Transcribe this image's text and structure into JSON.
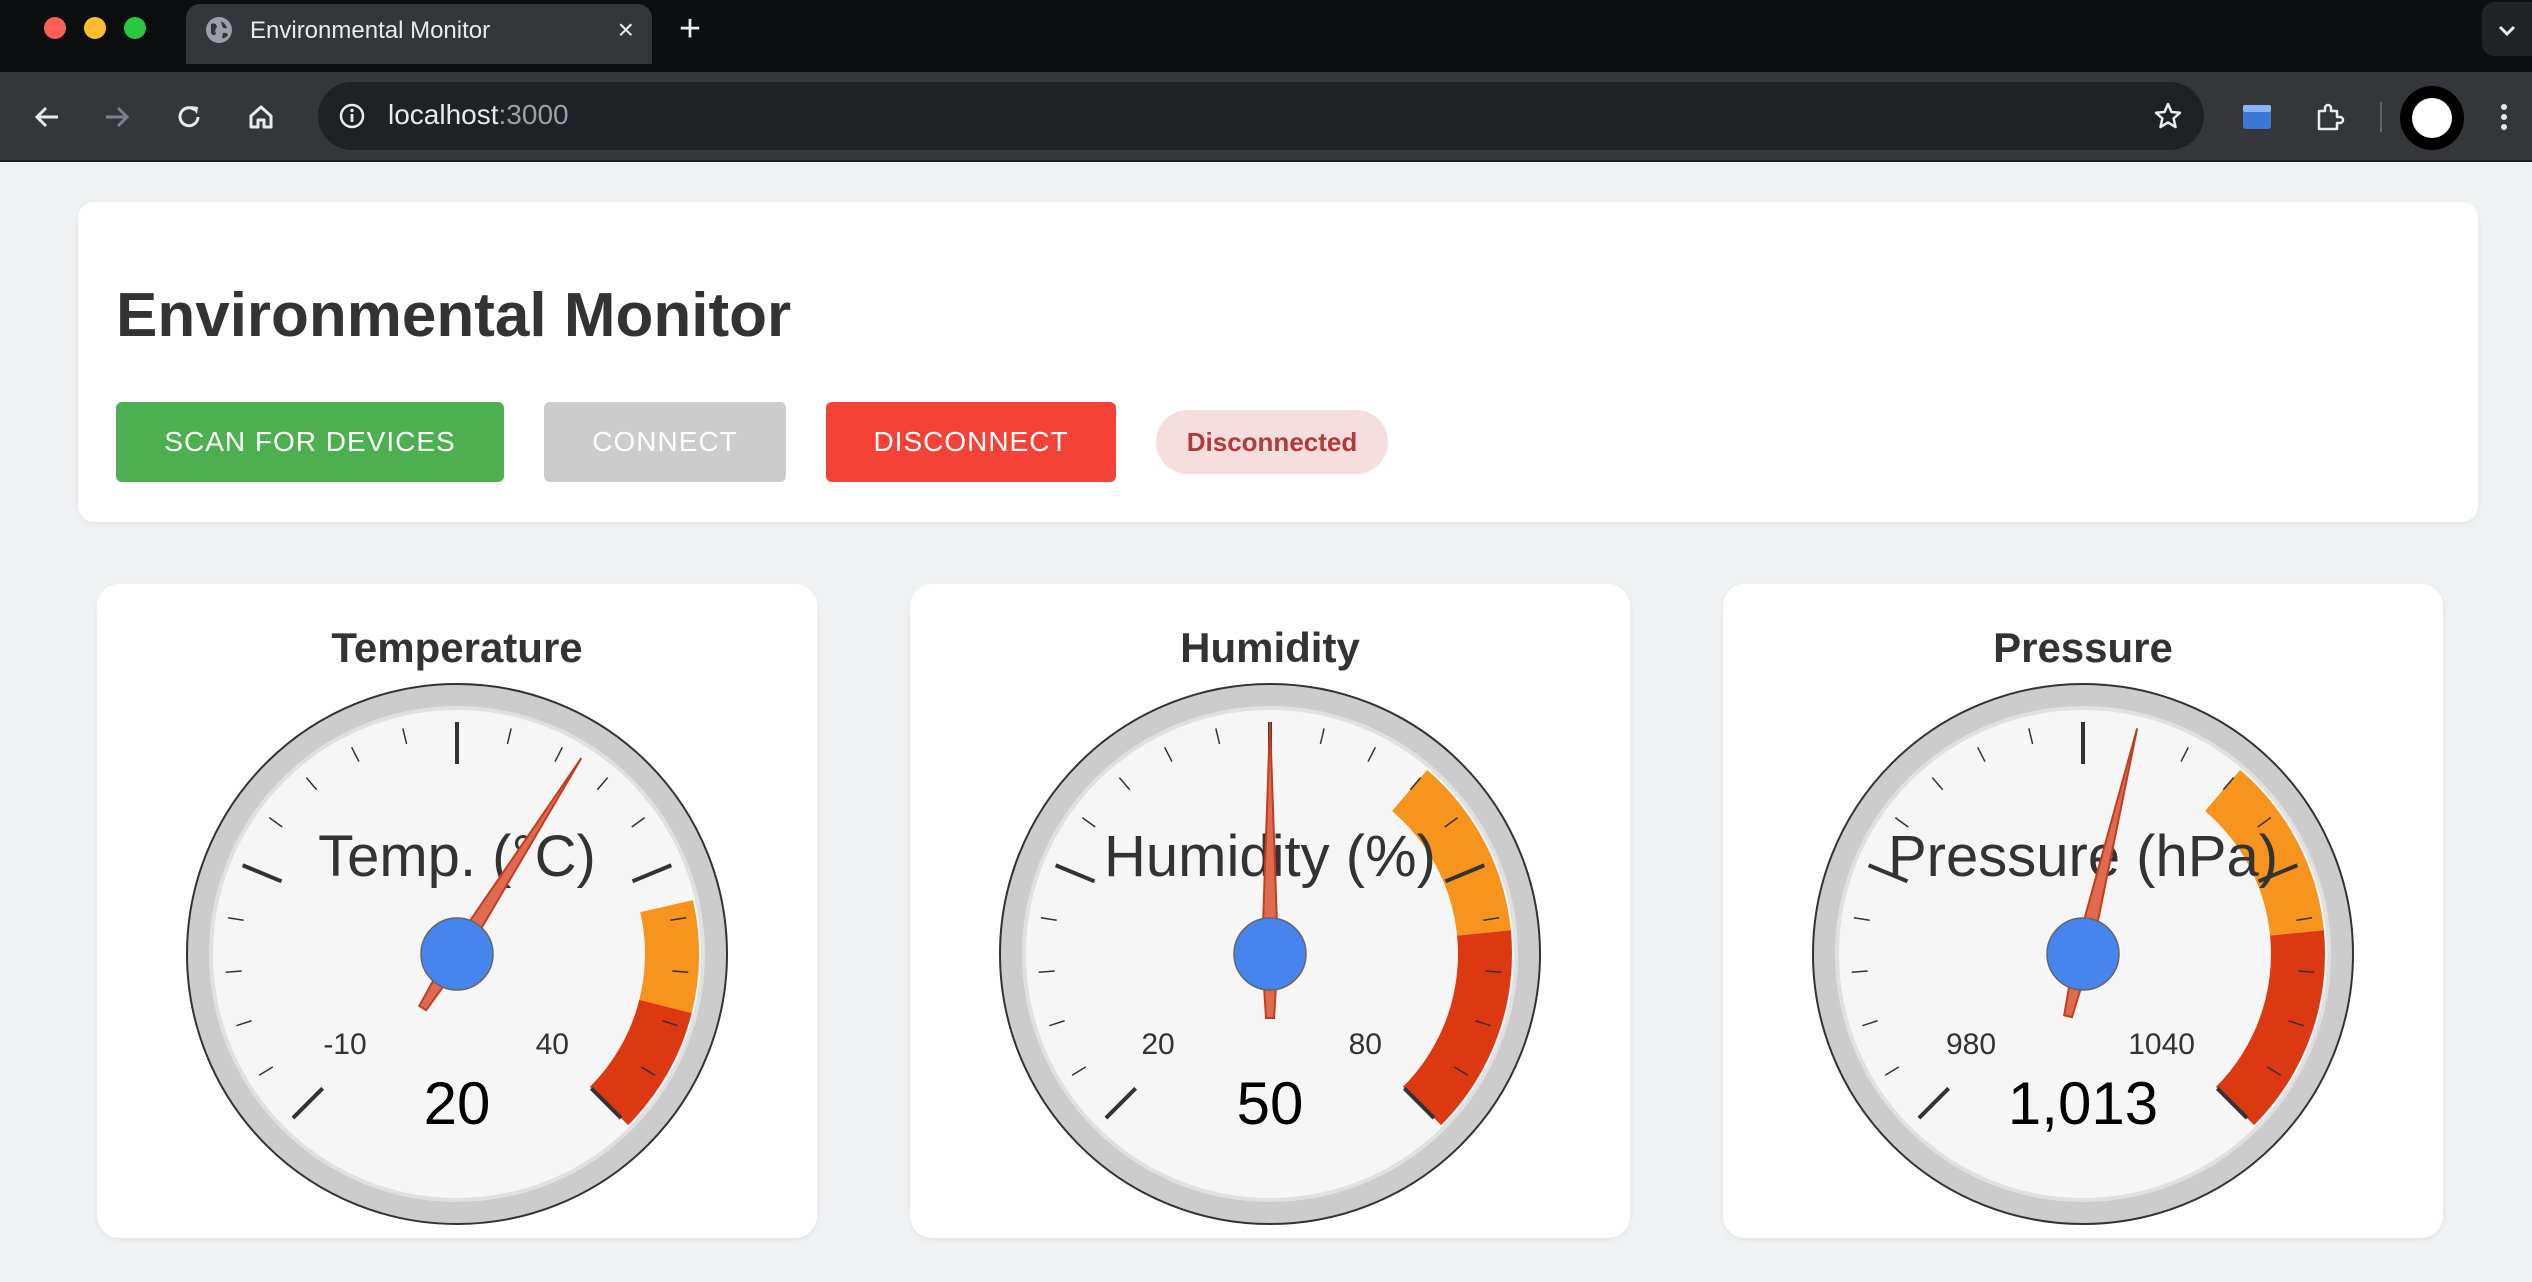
{
  "browser": {
    "tab_title": "Environmental Monitor",
    "url_host": "localhost",
    "url_port": ":3000"
  },
  "header": {
    "title": "Environmental Monitor",
    "scan_label": "SCAN FOR DEVICES",
    "connect_label": "CONNECT",
    "disconnect_label": "DISCONNECT",
    "status": "Disconnected"
  },
  "colors": {
    "scan": "#4caf50",
    "connect_disabled": "#cccccc",
    "disconnect": "#f44336",
    "status_bg": "#f5dede",
    "status_text": "#b23a3a",
    "zone_warning": "#f7941d",
    "zone_danger": "#dc3912",
    "needle": "#dc3912",
    "hub": "#4684ee"
  },
  "gauges": [
    {
      "title": "Temperature",
      "label": "Temp. (°C)",
      "value": 20,
      "value_text": "20",
      "min": -20,
      "max": 50,
      "min_label": "-10",
      "max_label": "40",
      "zones": [
        {
          "from": 35,
          "to": 42,
          "color": "#f7941d"
        },
        {
          "from": 42,
          "to": 50,
          "color": "#dc3912"
        }
      ],
      "needle_position": 0.62
    },
    {
      "title": "Humidity",
      "label": "Humidity (%)",
      "value": 50,
      "value_text": "50",
      "min": 10,
      "max": 90,
      "min_label": "20",
      "max_label": "80",
      "zones": [
        {
          "from": 62,
          "to": 75,
          "color": "#f7941d"
        },
        {
          "from": 75,
          "to": 90,
          "color": "#dc3912"
        }
      ],
      "needle_position": 0.5
    },
    {
      "title": "Pressure",
      "label": "Pressure (hPa)",
      "value": 1013,
      "value_text": "1,013",
      "min": 970,
      "max": 1050,
      "min_label": "980",
      "max_label": "1040",
      "zones": [
        {
          "from": 1022,
          "to": 1035,
          "color": "#f7941d"
        },
        {
          "from": 1035,
          "to": 1050,
          "color": "#dc3912"
        }
      ],
      "needle_position": 0.55
    }
  ]
}
